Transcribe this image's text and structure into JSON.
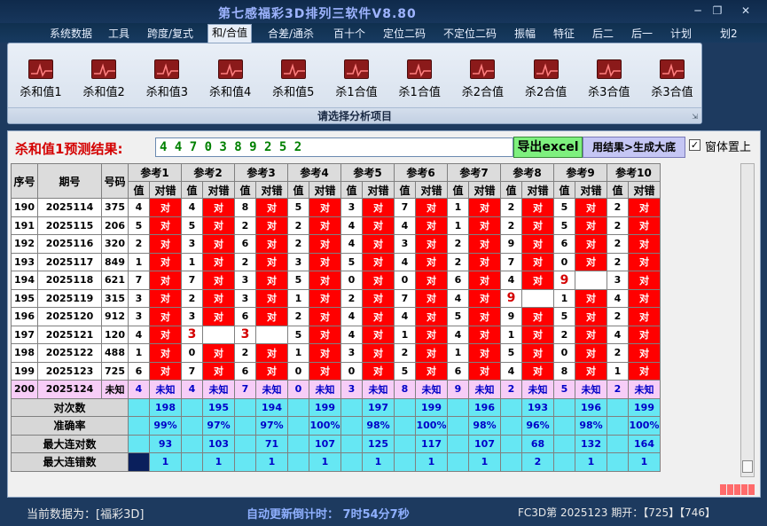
{
  "window": {
    "title": "第七感福彩3D排列三软件V8.80",
    "minimize_glyph": "─",
    "restore_glyph": "❐",
    "close_glyph": "✕"
  },
  "menu": {
    "items": [
      "系统数据",
      "工具",
      "跨度/复式",
      "和/合值",
      "合差/通杀",
      "百十个",
      "定位二码",
      "不定位二码",
      "振幅",
      "特征",
      "后二",
      "后一",
      "计划"
    ],
    "active_index": 3,
    "extra": "划2"
  },
  "ribbon": {
    "buttons": [
      "杀和值1",
      "杀和值2",
      "杀和值3",
      "杀和值4",
      "杀和值5",
      "杀1合值",
      "杀1合值",
      "杀2合值",
      "杀2合值",
      "杀3合值",
      "杀3合值"
    ],
    "icon_name": "chart-icon",
    "caption": "请选择分析项目",
    "expand_glyph": "⇲"
  },
  "prediction": {
    "label": "杀和值1预测结果:",
    "value": "4 4 7 0 3 8 9 2 5 2",
    "export_label": "导出excel",
    "generate_label": "用结果>生成大底",
    "ontop_label": "窗体置上",
    "ontop_checked": "✓"
  },
  "grid": {
    "headers": {
      "seq": "序号",
      "period": "期号",
      "number": "号码",
      "value": "值",
      "result": "对错"
    },
    "refs": [
      "参考1",
      "参考2",
      "参考3",
      "参考4",
      "参考5",
      "参考6",
      "参考7",
      "参考8",
      "参考9",
      "参考10"
    ],
    "hit_text": "对",
    "rows": [
      {
        "seq": "190",
        "period": "2025114",
        "number": "375",
        "vals": [
          "4",
          "4",
          "8",
          "5",
          "3",
          "7",
          "1",
          "2",
          "5",
          "2"
        ],
        "hits": [
          1,
          1,
          1,
          1,
          1,
          1,
          1,
          1,
          1,
          1
        ]
      },
      {
        "seq": "191",
        "period": "2025115",
        "number": "206",
        "vals": [
          "5",
          "5",
          "2",
          "2",
          "4",
          "4",
          "1",
          "2",
          "5",
          "2"
        ],
        "hits": [
          1,
          1,
          1,
          1,
          1,
          1,
          1,
          1,
          1,
          1
        ]
      },
      {
        "seq": "192",
        "period": "2025116",
        "number": "320",
        "vals": [
          "2",
          "3",
          "6",
          "2",
          "4",
          "3",
          "2",
          "9",
          "6",
          "2"
        ],
        "hits": [
          1,
          1,
          1,
          1,
          1,
          1,
          1,
          1,
          1,
          1
        ]
      },
      {
        "seq": "193",
        "period": "2025117",
        "number": "849",
        "vals": [
          "1",
          "1",
          "2",
          "3",
          "5",
          "4",
          "2",
          "7",
          "0",
          "2"
        ],
        "hits": [
          1,
          1,
          1,
          1,
          1,
          1,
          1,
          1,
          1,
          1
        ]
      },
      {
        "seq": "194",
        "period": "2025118",
        "number": "621",
        "vals": [
          "7",
          "7",
          "3",
          "5",
          "0",
          "0",
          "6",
          "4",
          "9",
          "3"
        ],
        "hits": [
          1,
          1,
          1,
          1,
          1,
          1,
          1,
          1,
          0,
          1
        ]
      },
      {
        "seq": "195",
        "period": "2025119",
        "number": "315",
        "vals": [
          "3",
          "2",
          "3",
          "1",
          "2",
          "7",
          "4",
          "9",
          "1",
          "4"
        ],
        "hits": [
          1,
          1,
          1,
          1,
          1,
          1,
          1,
          0,
          1,
          1
        ]
      },
      {
        "seq": "196",
        "period": "2025120",
        "number": "912",
        "vals": [
          "3",
          "3",
          "6",
          "2",
          "4",
          "4",
          "5",
          "9",
          "5",
          "2"
        ],
        "hits": [
          1,
          1,
          1,
          1,
          1,
          1,
          1,
          1,
          1,
          1
        ]
      },
      {
        "seq": "197",
        "period": "2025121",
        "number": "120",
        "vals": [
          "4",
          "3",
          "3",
          "5",
          "4",
          "1",
          "4",
          "1",
          "2",
          "4"
        ],
        "hits": [
          1,
          0,
          0,
          1,
          1,
          1,
          1,
          1,
          1,
          1
        ]
      },
      {
        "seq": "198",
        "period": "2025122",
        "number": "488",
        "vals": [
          "1",
          "0",
          "2",
          "1",
          "3",
          "2",
          "1",
          "5",
          "0",
          "2"
        ],
        "hits": [
          1,
          1,
          1,
          1,
          1,
          1,
          1,
          1,
          1,
          1
        ]
      },
      {
        "seq": "199",
        "period": "2025123",
        "number": "725",
        "vals": [
          "6",
          "7",
          "6",
          "0",
          "0",
          "5",
          "6",
          "4",
          "8",
          "1"
        ],
        "hits": [
          1,
          1,
          1,
          1,
          1,
          1,
          1,
          1,
          1,
          1
        ]
      }
    ],
    "pending": {
      "seq": "200",
      "period": "2025124",
      "number": "未知",
      "vals": [
        "4",
        "4",
        "7",
        "0",
        "3",
        "8",
        "9",
        "2",
        "5",
        "2"
      ],
      "unknown_text": "未知"
    },
    "stats": [
      {
        "label": "对次数",
        "values": [
          "198",
          "195",
          "194",
          "199",
          "197",
          "199",
          "196",
          "193",
          "196",
          "199"
        ]
      },
      {
        "label": "准确率",
        "values": [
          "99%",
          "97%",
          "97%",
          "100%",
          "98%",
          "100%",
          "98%",
          "96%",
          "98%",
          "100%"
        ]
      },
      {
        "label": "最大连对数",
        "values": [
          "93",
          "103",
          "71",
          "107",
          "125",
          "117",
          "107",
          "68",
          "132",
          "164"
        ]
      },
      {
        "label": "最大连错数",
        "values": [
          "1",
          "1",
          "1",
          "1",
          "1",
          "1",
          "1",
          "2",
          "1",
          "1"
        ]
      }
    ]
  },
  "status": {
    "data_source": "当前数据为：[福彩3D]",
    "timer": "自动更新倒计时：  7时54分7秒",
    "issue": "FC3D第  2025123  期开：【725】【746】"
  }
}
